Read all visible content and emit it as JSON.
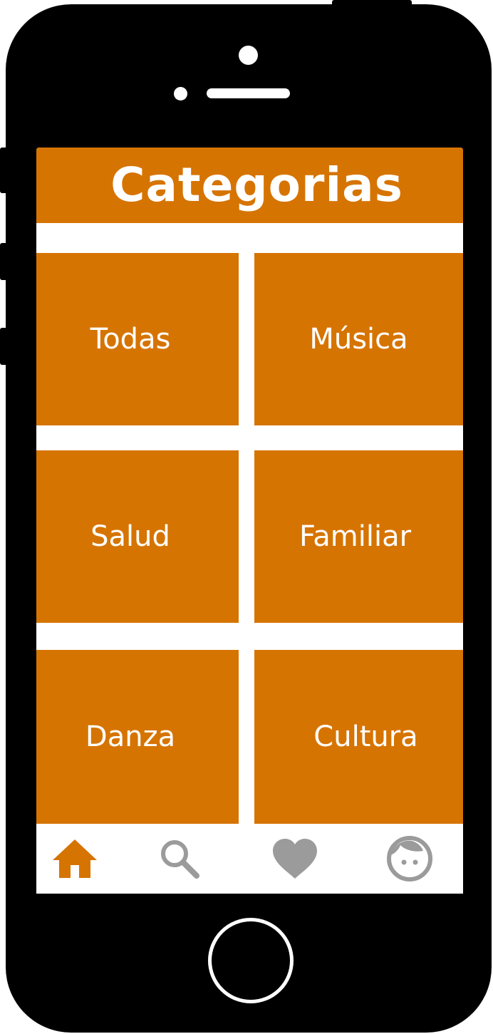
{
  "screen": {
    "title": "Categorias"
  },
  "categories": [
    {
      "label": "Todas"
    },
    {
      "label": "Música"
    },
    {
      "label": "Salud"
    },
    {
      "label": "Familiar"
    },
    {
      "label": "Danza"
    },
    {
      "label": "Cultura"
    }
  ],
  "tabbar": {
    "items": [
      {
        "icon": "home-icon",
        "active": true
      },
      {
        "icon": "search-icon",
        "active": false
      },
      {
        "icon": "heart-icon",
        "active": false
      },
      {
        "icon": "profile-icon",
        "active": false
      }
    ]
  },
  "colors": {
    "accent": "#d67402",
    "inactive_icon": "#9b9b9b",
    "phone_body": "#000000",
    "background": "#ffffff"
  }
}
